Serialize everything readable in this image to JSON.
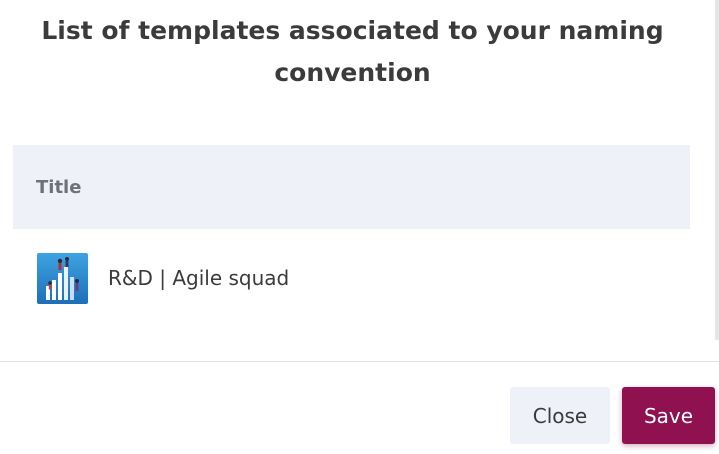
{
  "dialog": {
    "title": "List of templates associated to your naming convention"
  },
  "table": {
    "header": {
      "title_column": "Title"
    },
    "rows": [
      {
        "thumbnail_icon": "agile-squad-thumbnail",
        "name": "R&D | Agile squad"
      }
    ]
  },
  "footer": {
    "close_label": "Close",
    "save_label": "Save"
  },
  "colors": {
    "primary": "#8f1150",
    "header_bg": "#eef2f8",
    "secondary_button_bg": "#eef2f8"
  }
}
